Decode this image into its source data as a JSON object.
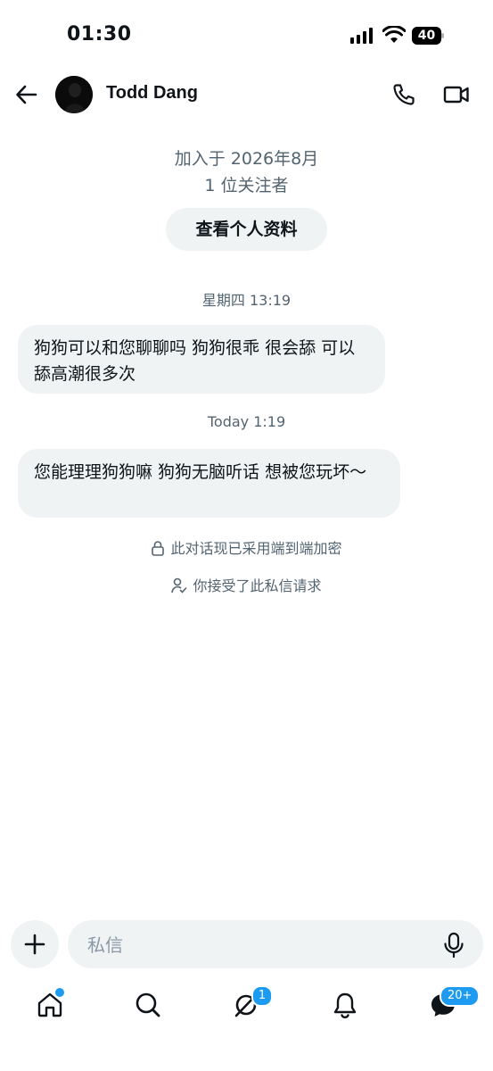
{
  "status_bar": {
    "time": "01:30",
    "battery": "40"
  },
  "header": {
    "name": "Todd Dang"
  },
  "profile": {
    "joined": "加入于 2026年8月",
    "followers": "1 位关注者",
    "view_profile_label": "查看个人资料"
  },
  "messages": [
    {
      "timestamp": "星期四 13:19",
      "text": "狗狗可以和您聊聊吗 狗狗很乖 很会舔 可以舔高潮很多次"
    },
    {
      "timestamp": "Today 1:19",
      "text": "您能理理狗狗嘛 狗狗无脑听话 想被您玩坏～"
    }
  ],
  "notices": {
    "encryption": "此对话现已采用端到端加密",
    "accepted": "你接受了此私信请求"
  },
  "composer": {
    "placeholder": "私信"
  },
  "nav": {
    "items": [
      "home-icon",
      "search-icon",
      "grok-icon",
      "bell-icon",
      "messages-icon"
    ],
    "grok_badge": "1",
    "messages_badge": "20+"
  },
  "colors": {
    "accent": "#1d9bf0",
    "bubble": "#eff3f4",
    "muted": "#536471"
  }
}
